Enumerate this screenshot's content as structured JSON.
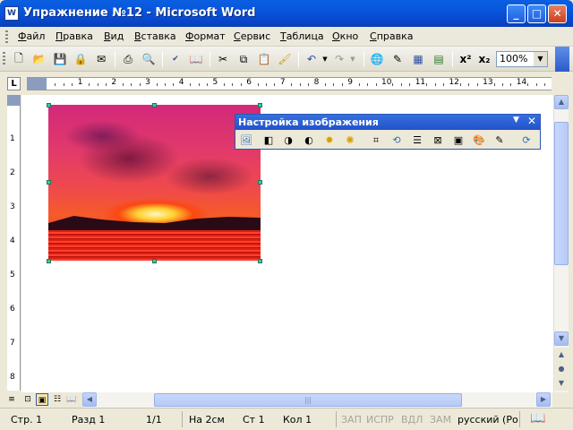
{
  "window": {
    "title": "Упражнение №12 - Microsoft Word",
    "app_icon": "W",
    "minimize_glyph": "_",
    "maximize_glyph": "□",
    "close_glyph": "✕"
  },
  "menubar": {
    "items": [
      "Файл",
      "Правка",
      "Вид",
      "Вставка",
      "Формат",
      "Сервис",
      "Таблица",
      "Окно",
      "Справка"
    ]
  },
  "toolbar": {
    "zoom": "100%",
    "icons": [
      "new-icon",
      "open-icon",
      "save-icon",
      "permission-icon",
      "email-icon",
      "print-icon",
      "print-preview-icon",
      "spelling-icon",
      "research-icon",
      "cut-icon",
      "copy-icon",
      "paste-icon",
      "format-painter-icon",
      "undo-icon",
      "redo-icon",
      "hyperlink-icon",
      "tables-borders-icon",
      "insert-table-icon",
      "insert-excel-icon",
      "superscript-icon",
      "subscript-icon"
    ]
  },
  "ruler": {
    "corner": "L",
    "numbers": [
      "1",
      "2",
      "3",
      "4",
      "5",
      "6",
      "7",
      "8",
      "9",
      "10",
      "11",
      "12",
      "13",
      "14"
    ],
    "vnumbers": [
      "1",
      "2",
      "3",
      "4",
      "5",
      "6",
      "7",
      "8"
    ]
  },
  "picture_toolbar": {
    "title": "Настройка изображения",
    "icons": [
      "insert-picture-icon",
      "color-icon",
      "more-contrast-icon",
      "less-contrast-icon",
      "more-brightness-icon",
      "less-brightness-icon",
      "crop-icon",
      "rotate-icon",
      "line-style-icon",
      "compress-icon",
      "text-wrapping-icon",
      "format-picture-icon",
      "set-transparent-color-icon",
      "reset-picture-icon"
    ]
  },
  "statusbar": {
    "page": "Стр. 1",
    "section": "Разд 1",
    "pages": "1/1",
    "at": "На 2см",
    "line": "Ст 1",
    "col": "Кол 1",
    "rec": "ЗАП",
    "trk": "ИСПР",
    "ext": "ВДЛ",
    "ovr": "ЗАМ",
    "language": "русский (Ро"
  },
  "colors": {
    "titlebar": "#0855DD",
    "selection_handle": "#3CC7A0",
    "picture_toolbar_title": "#2352C9"
  }
}
